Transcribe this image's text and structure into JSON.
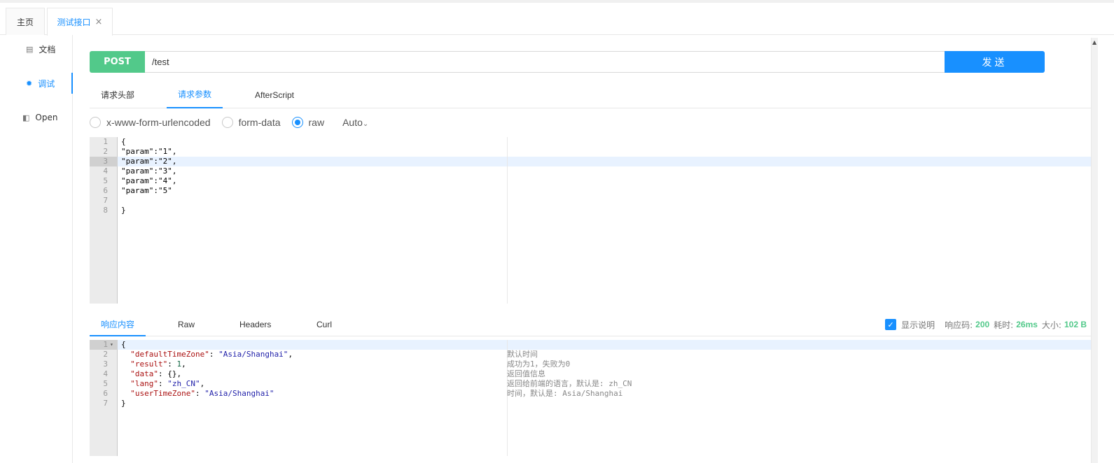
{
  "tabs": {
    "home": "主页",
    "active": "测试接口",
    "close": "×"
  },
  "sidebar": {
    "items": [
      {
        "label": "文档",
        "icon": "document-icon"
      },
      {
        "label": "调试",
        "icon": "bug-icon"
      },
      {
        "label": "Open",
        "icon": "file-icon"
      }
    ]
  },
  "request": {
    "method": "POST",
    "url": "/test",
    "send_label": "发送",
    "tabs": [
      "请求头部",
      "请求参数",
      "AfterScript"
    ],
    "active_tab": "请求参数",
    "body_types": [
      "x-www-form-urlencoded",
      "form-data",
      "raw"
    ],
    "selected_body_type": "raw",
    "raw_format": "Auto",
    "body_lines": [
      "{",
      "\"param\":\"1\",",
      "\"param\":\"2\",",
      "\"param\":\"3\",",
      "\"param\":\"4\",",
      "\"param\":\"5\"",
      "",
      "}"
    ],
    "line_numbers": [
      "1",
      "2",
      "3",
      "4",
      "5",
      "6",
      "7",
      "8"
    ]
  },
  "response": {
    "tabs": [
      "响应内容",
      "Raw",
      "Headers",
      "Curl"
    ],
    "active_tab": "响应内容",
    "show_desc_label": "显示说明",
    "show_desc_checked": true,
    "status_label": "响应码:",
    "status_value": "200",
    "time_label": "耗时:",
    "time_value": "26ms",
    "size_label": "大小:",
    "size_value": "102 B",
    "line_numbers": [
      "1",
      "2",
      "3",
      "4",
      "5",
      "6",
      "7"
    ],
    "comments": [
      "默认时间",
      "成功为1，失败为0",
      "返回值信息",
      "返回给前端的语言，默认是: zh_CN",
      "时间，默认是: Asia/Shanghai"
    ]
  },
  "colors": {
    "accent": "#1890ff",
    "method": "#52c98a",
    "success": "#52c98a"
  }
}
